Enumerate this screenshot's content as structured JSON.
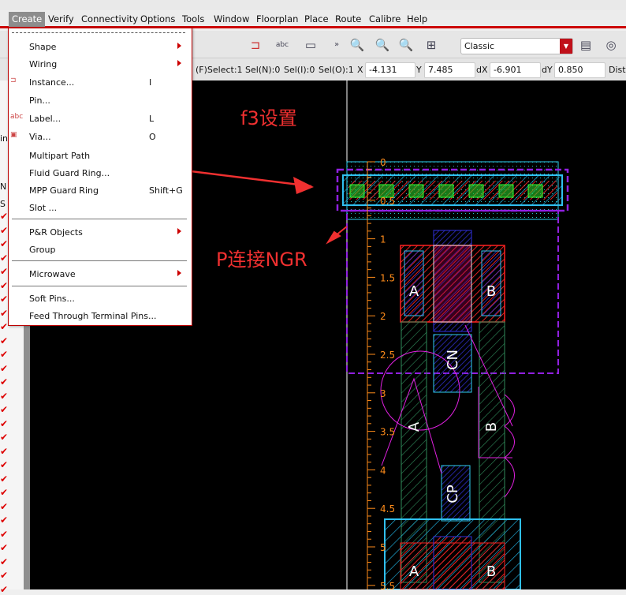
{
  "menubar": {
    "items": [
      {
        "label": "Create",
        "active": true
      },
      {
        "label": "Verify"
      },
      {
        "label": "Connectivity"
      },
      {
        "label": "Options"
      },
      {
        "label": "Tools"
      },
      {
        "label": "Window"
      },
      {
        "label": "Floorplan"
      },
      {
        "label": "Place"
      },
      {
        "label": "Route"
      },
      {
        "label": "Calibre"
      },
      {
        "label": "Help"
      }
    ]
  },
  "toolbar": {
    "display_mode": "Classic",
    "icons": [
      "zoom-in-icon",
      "zoom-out-icon",
      "zoom-fit-icon",
      "zoom-area-icon",
      "window-icon",
      "visibility-icon"
    ]
  },
  "status": {
    "select": "(F)Select:1",
    "sel_n": "Sel(N):0",
    "sel_i": "Sel(I):0",
    "sel_o": "Sel(O):1",
    "x_label": "X",
    "x": "-4.131",
    "y_label": "Y",
    "y": "7.485",
    "dx_label": "dX",
    "dx": "-6.901",
    "dy_label": "dY",
    "dy": "0.850",
    "dist_label": "Dist"
  },
  "left_panel": {
    "labels": [
      "in",
      "N",
      "S"
    ]
  },
  "menu": {
    "items": [
      {
        "label": "Shape",
        "submenu": true
      },
      {
        "label": "Wiring",
        "submenu": true
      },
      {
        "label": "Instance...",
        "shortcut": "I"
      },
      {
        "label": "Pin..."
      },
      {
        "label": "Label...",
        "shortcut": "L"
      },
      {
        "label": "Via...",
        "shortcut": "O"
      },
      {
        "label": "Multipart Path"
      },
      {
        "label": "Fluid Guard Ring..."
      },
      {
        "label": "MPP Guard Ring",
        "shortcut": "Shift+G"
      },
      {
        "label": "Slot ..."
      },
      {
        "label": "P&R Objects",
        "submenu": true
      },
      {
        "label": "Group"
      },
      {
        "label": "Microwave",
        "submenu": true
      },
      {
        "label": "Soft Pins..."
      },
      {
        "label": "Feed Through Terminal Pins..."
      }
    ]
  },
  "annotations": {
    "f3": "f3设置",
    "p_ngr": "P连接NGR",
    "color": "#f03030"
  },
  "canvas": {
    "ruler_labels": [
      "0",
      "0.5",
      "1",
      "1.5",
      "2",
      "2.5",
      "3",
      "3.5",
      "4",
      "4.5",
      "5",
      "5.5"
    ],
    "pin_labels": [
      "A",
      "B",
      "CN",
      "A",
      "B",
      "CP",
      "A",
      "B"
    ],
    "ruler_color": "#ff8c1a"
  }
}
